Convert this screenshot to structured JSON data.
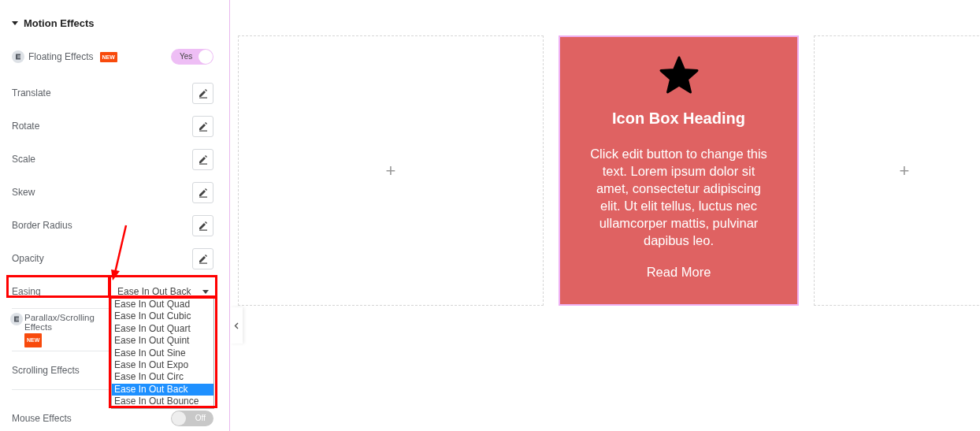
{
  "section": {
    "title": "Motion Effects",
    "expanded": true
  },
  "floating": {
    "label": "Floating Effects",
    "badge": "NEW",
    "toggle": {
      "label": "Yes",
      "on": true
    }
  },
  "properties": [
    {
      "label": "Translate"
    },
    {
      "label": "Rotate"
    },
    {
      "label": "Scale"
    },
    {
      "label": "Skew"
    },
    {
      "label": "Border Radius"
    },
    {
      "label": "Opacity"
    }
  ],
  "easing": {
    "label": "Easing",
    "value": "Ease In Out Back",
    "open": true,
    "options": [
      {
        "label": "Ease In Out Quad",
        "selected": false
      },
      {
        "label": "Ease In Out Cubic",
        "selected": false
      },
      {
        "label": "Ease In Out Quart",
        "selected": false
      },
      {
        "label": "Ease In Out Quint",
        "selected": false
      },
      {
        "label": "Ease In Out Sine",
        "selected": false
      },
      {
        "label": "Ease In Out Expo",
        "selected": false
      },
      {
        "label": "Ease In Out Circ",
        "selected": false
      },
      {
        "label": "Ease In Out Back",
        "selected": true
      },
      {
        "label": "Ease In Out Bounce",
        "selected": false
      }
    ]
  },
  "parallax": {
    "label": "Parallax/Scrolling Effects",
    "badge": "NEW"
  },
  "scrolling": {
    "label": "Scrolling Effects"
  },
  "mouse": {
    "label": "Mouse Effects",
    "toggle": {
      "label": "Off",
      "on": false
    }
  },
  "canvas": {
    "columns": [
      {
        "kind": "empty",
        "add": "+"
      },
      {
        "kind": "icon-box",
        "heading": "Icon Box Heading",
        "text": "Click edit button to change this text. Lorem ipsum dolor sit amet, consectetur adipiscing elit. Ut elit tellus, luctus nec ullamcorper mattis, pulvinar dapibus leo.",
        "link": "Read More"
      },
      {
        "kind": "empty",
        "add": "+"
      }
    ]
  }
}
